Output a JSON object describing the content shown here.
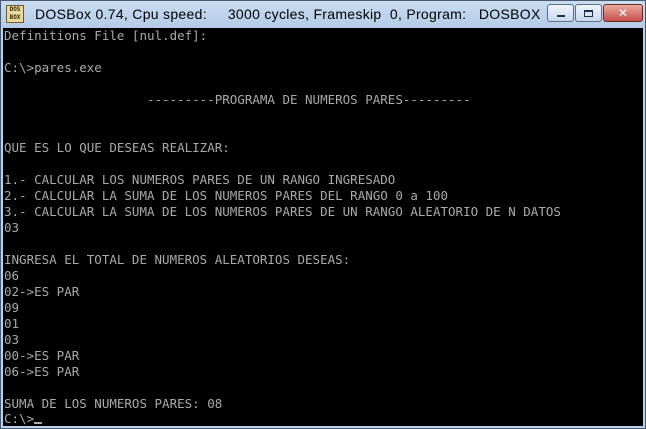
{
  "window": {
    "title": "DOSBox 0.74, Cpu speed:     3000 cycles, Frameskip  0, Program:   DOSBOX",
    "icon_label": "DOS BOX",
    "icon": "dosbox-icon",
    "controls": {
      "minimize_icon": "minimize-icon",
      "maximize_icon": "maximize-icon",
      "close_icon": "close-icon",
      "close_glyph": "✕"
    }
  },
  "colors": {
    "console_bg": "#000000",
    "console_text": "#aaaaaa",
    "titlebar": "#b9d1ea",
    "close_button": "#c75050"
  },
  "console": {
    "lines": [
      "Definitions File [nul.def]:",
      "",
      "C:\\>pares.exe",
      "",
      "                   ---------PROGRAMA DE NUMEROS PARES---------",
      "",
      "",
      "QUE ES LO QUE DESEAS REALIZAR:",
      "",
      "1.- CALCULAR LOS NUMEROS PARES DE UN RANGO INGRESADO",
      "2.- CALCULAR LA SUMA DE LOS NUMEROS PARES DEL RANGO 0 a 100",
      "3.- CALCULAR LA SUMA DE LOS NUMEROS PARES DE UN RANGO ALEATORIO DE N DATOS",
      "03",
      "",
      "INGRESA EL TOTAL DE NUMEROS ALEATORIOS DESEAS:",
      "06",
      "02->ES PAR",
      "09",
      "01",
      "03",
      "00->ES PAR",
      "06->ES PAR",
      "",
      "SUMA DE LOS NUMEROS PARES: 08"
    ],
    "prompt": "C:\\>"
  }
}
